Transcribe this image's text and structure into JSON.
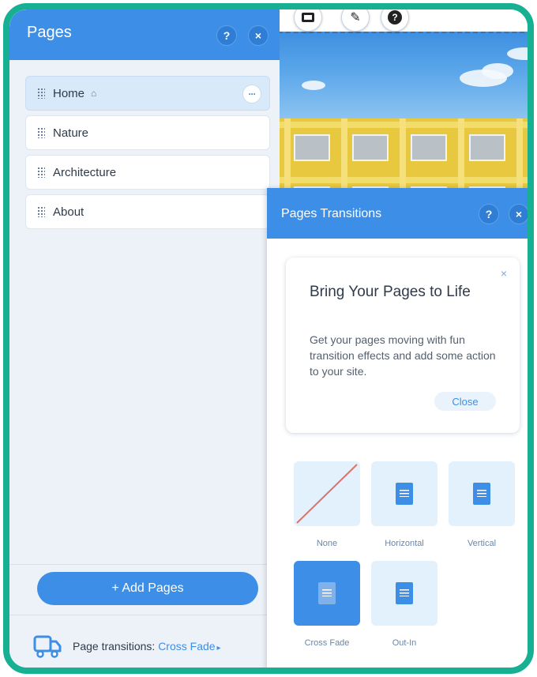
{
  "colors": {
    "accent": "#3d8ee6",
    "frame": "#17b093",
    "panel_bg": "#edf2f9",
    "selected_item": "#d8e9f9"
  },
  "pages_panel": {
    "title": "Pages",
    "help_label": "?",
    "close_label": "×",
    "items": [
      {
        "label": "Home",
        "is_home": true,
        "selected": true,
        "more_label": "···"
      },
      {
        "label": "Nature"
      },
      {
        "label": "Architecture"
      },
      {
        "label": "About"
      }
    ],
    "add_button_label": "+ Add Pages",
    "footer": {
      "prefix": "Page transitions:",
      "value": "Cross Fade",
      "arrow": "▸"
    }
  },
  "transitions_panel": {
    "title": "Pages Transitions",
    "help_label": "?",
    "close_label": "×",
    "promo": {
      "close_label": "×",
      "title": "Bring Your Pages to Life",
      "body": "Get your pages moving with fun transition effects and add some action to your site.",
      "button_label": "Close"
    },
    "options": [
      {
        "label": "None",
        "icon": "none-slash-icon"
      },
      {
        "label": "Horizontal",
        "icon": "horizontal-doc-icon"
      },
      {
        "label": "Vertical",
        "icon": "vertical-doc-icon"
      },
      {
        "label": "Cross Fade",
        "icon": "cross-fade-doc-icon",
        "selected": true
      },
      {
        "label": "Out-In",
        "icon": "out-in-doc-icon"
      }
    ]
  },
  "canvas_toolbar": {
    "help_label": "?"
  }
}
